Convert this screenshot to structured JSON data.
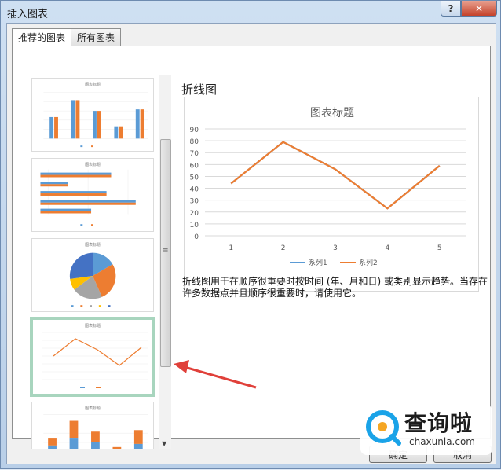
{
  "window": {
    "title": "插入图表",
    "help_glyph": "?",
    "close_glyph": "✕"
  },
  "tabs": [
    {
      "label": "推荐的图表",
      "active": true
    },
    {
      "label": "所有图表",
      "active": false
    }
  ],
  "thumbnails": [
    {
      "kind": "clustered-column",
      "title": "图表标题",
      "selected": false
    },
    {
      "kind": "clustered-bar",
      "title": "图表标题",
      "selected": false
    },
    {
      "kind": "pie",
      "title": "图表标题",
      "selected": false
    },
    {
      "kind": "line",
      "title": "图表标题",
      "selected": true
    },
    {
      "kind": "stacked-column",
      "title": "图表标题",
      "selected": false
    }
  ],
  "preview": {
    "chart_type_name": "折线图",
    "description": "折线图用于在顺序很重要时按时间 (年、月和日) 或类别显示趋势。当存在许多数据点并且顺序很重要时，请使用它。"
  },
  "chart_data": {
    "type": "line",
    "title": "图表标题",
    "categories": [
      "1",
      "2",
      "3",
      "4",
      "5"
    ],
    "series": [
      {
        "name": "系列1",
        "values": [
          44,
          79,
          56,
          23,
          59
        ],
        "color": "#5b9bd5",
        "hidden_behind": true
      },
      {
        "name": "系列2",
        "values": [
          44,
          79,
          56,
          23,
          59
        ],
        "color": "#ed7d31"
      }
    ],
    "ylim": [
      0,
      90
    ],
    "yticks": [
      0,
      10,
      20,
      30,
      40,
      50,
      60,
      70,
      80,
      90
    ],
    "grid": true,
    "legend": "bottom"
  },
  "footer": {
    "ok_label": "确定",
    "cancel_label": "取消"
  },
  "watermark": {
    "cn": "查询啦",
    "en": "chaxunla.com"
  },
  "colors": {
    "series1": "#5b9bd5",
    "series2": "#ed7d31",
    "series3": "#a5a5a5",
    "series4": "#ffc000",
    "selection": "#a8d5be",
    "arrow": "#e0403a"
  }
}
